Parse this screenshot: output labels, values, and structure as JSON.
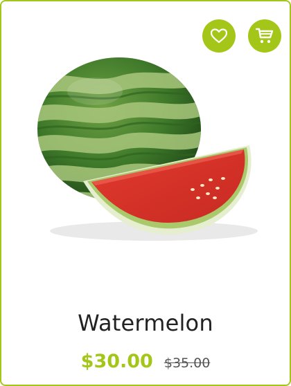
{
  "card": {
    "accent_color": "#a4c619",
    "actions": {
      "wishlist_icon": "heart-icon",
      "cart_icon": "shopping-cart-icon"
    },
    "product": {
      "image": "watermelon-image",
      "name": "Watermelon",
      "price": "$30.00",
      "original_price": "$35.00"
    }
  }
}
